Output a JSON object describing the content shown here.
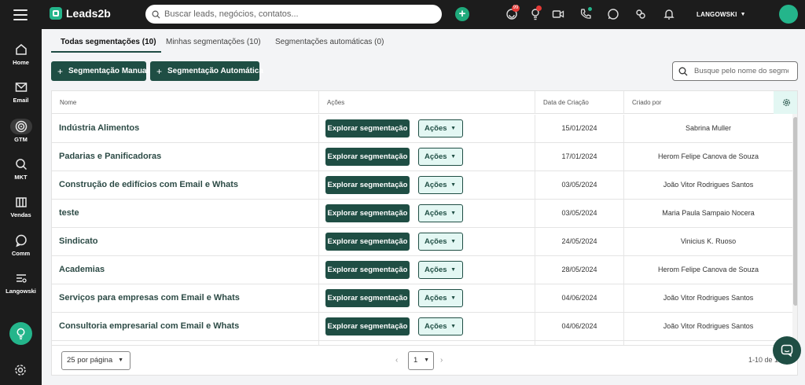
{
  "app": {
    "name": "Leads2b"
  },
  "topbar": {
    "search_placeholder": "Buscar leads, negócios, contatos...",
    "notifications_badge": "99",
    "user_name": "LANGOWSKI"
  },
  "sidebar": {
    "items": [
      {
        "label": "Home"
      },
      {
        "label": "Email"
      },
      {
        "label": "GTM"
      },
      {
        "label": "MKT"
      },
      {
        "label": "Vendas"
      },
      {
        "label": "Comm"
      },
      {
        "label": "Langowski"
      }
    ]
  },
  "tabs": [
    {
      "label": "Todas segmentações (10)"
    },
    {
      "label": "Minhas segmentações (10)"
    },
    {
      "label": "Segmentações automáticas (0)"
    }
  ],
  "toolbar": {
    "manual_label": "Segmentação Manual",
    "auto_label": "Segmentação Automática",
    "search_placeholder": "Busque pelo nome do segmento"
  },
  "table": {
    "headers": {
      "name": "Nome",
      "actions": "Ações",
      "date": "Data de Criação",
      "owner": "Criado por"
    },
    "explore_label": "Explorar segmentação",
    "actions_label": "Ações",
    "rows": [
      {
        "name": "Indústria Alimentos",
        "date": "15/01/2024",
        "owner": "Sabrina Muller"
      },
      {
        "name": "Padarias e Panificadoras",
        "date": "17/01/2024",
        "owner": "Herom Felipe Canova de Souza"
      },
      {
        "name": "Construção de edifícios com Email e Whats",
        "date": "03/05/2024",
        "owner": "João Vitor Rodrigues Santos"
      },
      {
        "name": "teste",
        "date": "03/05/2024",
        "owner": "Maria Paula Sampaio Nocera"
      },
      {
        "name": "Sindicato",
        "date": "24/05/2024",
        "owner": "Vinicius K. Ruoso"
      },
      {
        "name": "Academias",
        "date": "28/05/2024",
        "owner": "Herom Felipe Canova de Souza"
      },
      {
        "name": "Serviços para empresas com Email e Whats",
        "date": "04/06/2024",
        "owner": "João Vitor Rodrigues Santos"
      },
      {
        "name": "Consultoria empresarial com Email e Whats",
        "date": "04/06/2024",
        "owner": "João Vitor Rodrigues Santos"
      }
    ]
  },
  "footer": {
    "per_page": "25 por página",
    "page": "1",
    "range": "1-10 de 10"
  },
  "colors": {
    "brand": "#24b58b",
    "primary_dark": "#1f4e44",
    "topbar": "#1c1c1c"
  }
}
